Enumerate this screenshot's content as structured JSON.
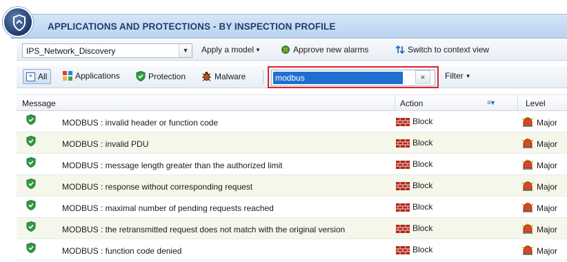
{
  "title": "APPLICATIONS AND PROTECTIONS - BY INSPECTION PROFILE",
  "toolbar1": {
    "profile_select_value": "IPS_Network_Discovery",
    "apply_model_label": "Apply a model",
    "approve_alarms_label": "Approve new alarms",
    "context_view_label": "Switch to context view"
  },
  "toolbar2": {
    "all_label": "All",
    "applications_label": "Applications",
    "protection_label": "Protection",
    "malware_label": "Malware",
    "search_value": "modbus",
    "clear_glyph": "×",
    "filter_label": "Filter"
  },
  "columns": {
    "message": "Message",
    "action": "Action",
    "level": "Level"
  },
  "rows": [
    {
      "message": "MODBUS : invalid header or function code",
      "action": "Block",
      "level": "Major"
    },
    {
      "message": "MODBUS : invalid PDU",
      "action": "Block",
      "level": "Major"
    },
    {
      "message": "MODBUS : message length greater than the authorized limit",
      "action": "Block",
      "level": "Major"
    },
    {
      "message": "MODBUS : response without corresponding request",
      "action": "Block",
      "level": "Major"
    },
    {
      "message": "MODBUS : maximal number of pending requests reached",
      "action": "Block",
      "level": "Major"
    },
    {
      "message": "MODBUS : the retransmitted request does not match with the original version",
      "action": "Block",
      "level": "Major"
    },
    {
      "message": "MODBUS : function code denied",
      "action": "Block",
      "level": "Major"
    }
  ],
  "colors": {
    "accent": "#1f6fd1",
    "highlight_border": "#e0202a",
    "alt_row": "#f4f7e9"
  }
}
